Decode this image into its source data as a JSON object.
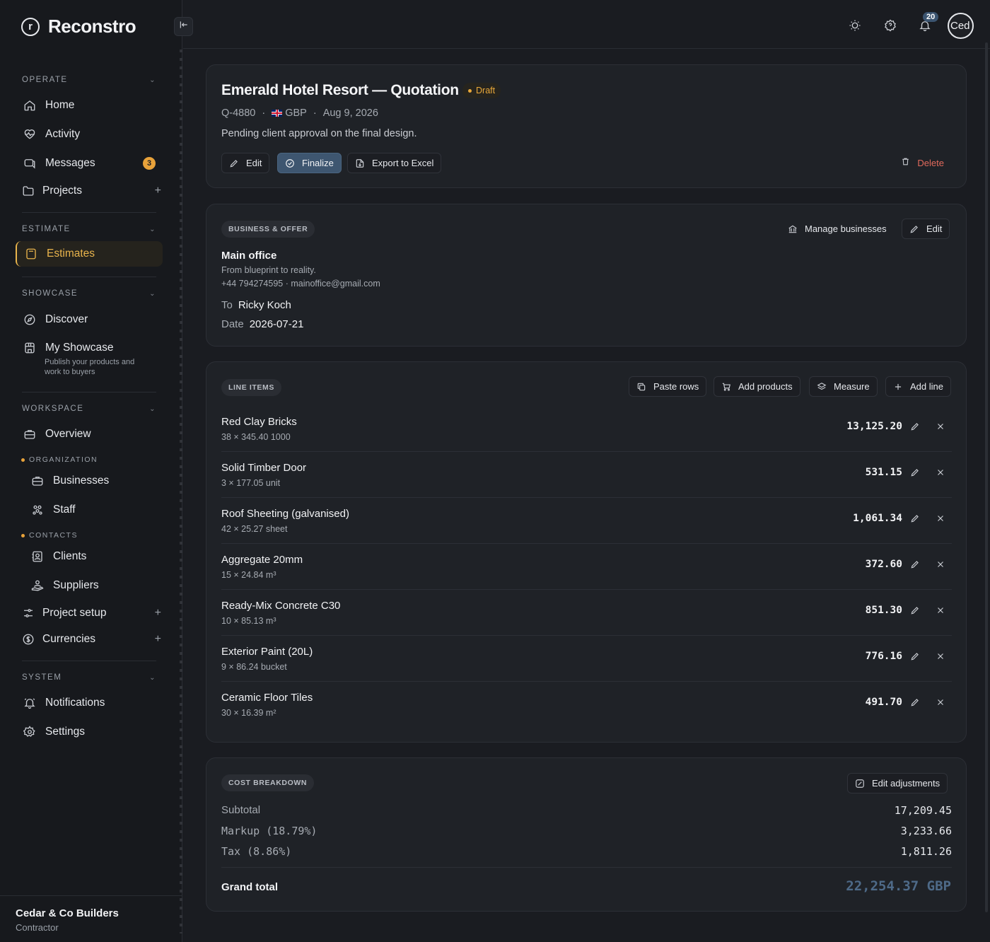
{
  "brand": {
    "name": "Reconstro",
    "logo_letter": "r"
  },
  "sidebar": {
    "sections": [
      {
        "label": "OPERATE"
      },
      {
        "label": "ESTIMATE"
      },
      {
        "label": "SHOWCASE"
      },
      {
        "label": "WORKSPACE"
      },
      {
        "label": "SYSTEM"
      }
    ],
    "items": {
      "home": "Home",
      "activity": "Activity",
      "messages": "Messages",
      "messages_badge": "3",
      "projects": "Projects",
      "estimates": "Estimates",
      "discover": "Discover",
      "my_showcase": "My Showcase",
      "my_showcase_sub": "Publish your products and work to buyers",
      "overview": "Overview",
      "organization_head": "ORGANIZATION",
      "businesses": "Businesses",
      "staff": "Staff",
      "contacts_head": "CONTACTS",
      "clients": "Clients",
      "suppliers": "Suppliers",
      "project_setup": "Project setup",
      "currencies": "Currencies",
      "notifications": "Notifications",
      "settings": "Settings"
    },
    "org": {
      "name": "Cedar & Co Builders",
      "role": "Contractor"
    }
  },
  "topbar": {
    "notif_count": "20",
    "avatar_text": "Ced"
  },
  "quote": {
    "title": "Emerald Hotel Resort — Quotation",
    "status": "Draft",
    "number": "Q-4880",
    "currency": "GBP",
    "date": "Aug 9, 2026",
    "description": "Pending client approval on the final design.",
    "actions": {
      "edit": "Edit",
      "finalize": "Finalize",
      "export": "Export to Excel",
      "delete": "Delete"
    }
  },
  "business": {
    "pill": "BUSINESS & OFFER",
    "manage": "Manage businesses",
    "edit": "Edit",
    "name": "Main office",
    "tagline": "From blueprint to reality.",
    "contact": "+44 794274595 · mainoffice@gmail.com",
    "to_label": "To",
    "to_value": "Ricky Koch",
    "date_label": "Date",
    "date_value": "2026-07-21"
  },
  "line_items": {
    "pill": "LINE ITEMS",
    "actions": {
      "paste": "Paste rows",
      "add_products": "Add products",
      "measure": "Measure",
      "add_line": "Add line"
    },
    "rows": [
      {
        "name": "Red Clay Bricks",
        "sub": "38 × 345.40 1000",
        "amount": "13,125.20"
      },
      {
        "name": "Solid Timber Door",
        "sub": "3 × 177.05 unit",
        "amount": "531.15"
      },
      {
        "name": "Roof Sheeting (galvanised)",
        "sub": "42 × 25.27 sheet",
        "amount": "1,061.34"
      },
      {
        "name": "Aggregate 20mm",
        "sub": "15 × 24.84 m³",
        "amount": "372.60"
      },
      {
        "name": "Ready-Mix Concrete C30",
        "sub": "10 × 85.13 m³",
        "amount": "851.30"
      },
      {
        "name": "Exterior Paint (20L)",
        "sub": "9 × 86.24 bucket",
        "amount": "776.16"
      },
      {
        "name": "Ceramic Floor Tiles",
        "sub": "30 × 16.39 m²",
        "amount": "491.70"
      }
    ]
  },
  "cost": {
    "pill": "COST BREAKDOWN",
    "edit_adjustments": "Edit adjustments",
    "subtotal_label": "Subtotal",
    "subtotal": "17,209.45",
    "markup_label": "Markup (18.79%)",
    "markup": "3,233.66",
    "tax_label": "Tax (8.86%)",
    "tax": "1,811.26",
    "grand_label": "Grand total",
    "grand": "22,254.37 GBP"
  },
  "colors": {
    "accent": "#e9b44c",
    "primary": "#3e5670",
    "danger": "#e26a5c",
    "grand_total": "#4e6a88"
  }
}
